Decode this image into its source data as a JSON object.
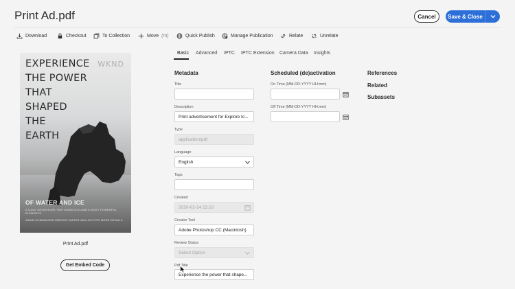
{
  "header": {
    "title": "Print Ad.pdf",
    "cancel_label": "Cancel",
    "save_label": "Save & Close"
  },
  "toolbar": [
    {
      "label": "Download",
      "icon": "download-icon"
    },
    {
      "label": "Checkout",
      "icon": "lock-icon"
    },
    {
      "label": "To Collection",
      "icon": "collection-icon"
    },
    {
      "label": "Move",
      "suffix": "(m)",
      "icon": "plus-icon"
    },
    {
      "label": "Quick Publish",
      "icon": "globe-icon"
    },
    {
      "label": "Manage Publication",
      "icon": "publication-icon"
    },
    {
      "label": "Relate",
      "icon": "link-icon"
    },
    {
      "label": "Unrelate",
      "icon": "unlink-icon"
    }
  ],
  "tabs": [
    "Basic",
    "Advanced",
    "IPTC",
    "IPTC Extension",
    "Camera Data",
    "Insights"
  ],
  "active_tab": "Basic",
  "asset": {
    "filename": "Print Ad.pdf",
    "embed_label": "Get Embed Code",
    "poster": {
      "headline": [
        "EXPERIENCE",
        "THE POWER",
        "THAT",
        "SHAPED",
        "THE",
        "EARTH"
      ],
      "brand": "WKND",
      "subhead": "OF WATER AND ICE",
      "tagline": "A 5-DAY ADVENTURE TRIP USING ICELAND'S MOST POWERFUL ELEMENTS",
      "cta": "WKND.COM/ADVENTURES/OF-WATER-AND-ICE FOR MORE DETAILS."
    }
  },
  "metadata": {
    "heading": "Metadata",
    "title_label": "Title",
    "title_value": "",
    "description_label": "Description",
    "description_value": "Print advertisement for Explore Ic...",
    "type_label": "Type",
    "type_value": "application/pdf",
    "language_label": "Language",
    "language_value": "English",
    "tags_label": "Tags",
    "tags_value": "",
    "created_label": "Created",
    "created_value": "2020-02-14 15:10",
    "creator_label": "Creator Tool",
    "creator_value": "Adobe Photoshop CC (Macintosh)",
    "review_label": "Review Status",
    "review_placeholder": "Select Option",
    "pdf_title_label": "Pdf Title",
    "pdf_title_value": "Experience the power that shape..."
  },
  "schedule": {
    "heading": "Scheduled (de)activation",
    "on_label": "On Time (MM-DD-YYYY HH:mm)",
    "on_value": "",
    "off_label": "Off Time (MM-DD-YYYY HH:mm)",
    "off_value": ""
  },
  "sidebar": {
    "references": "References",
    "related": "Related",
    "subassets": "Subassets"
  },
  "colors": {
    "accent": "#2d6fd8",
    "background": "#f4f4f4"
  }
}
